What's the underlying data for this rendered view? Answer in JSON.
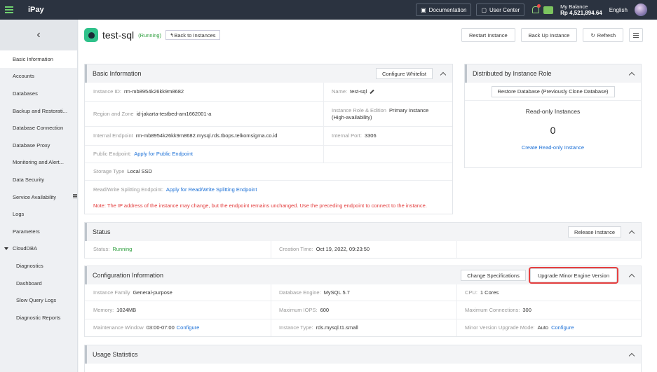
{
  "topbar": {
    "logo": "iPay",
    "documentation": "Documentation",
    "user_center": "User Center",
    "balance_label": "My Balance",
    "balance_value": "Rp 4,521,894.64",
    "language": "English"
  },
  "sidebar": {
    "items": [
      "Basic Information",
      "Accounts",
      "Databases",
      "Backup and Restorati...",
      "Database Connection",
      "Database Proxy",
      "Monitoring and Alert...",
      "Data Security",
      "Service Availability",
      "Logs",
      "Parameters"
    ],
    "group": "CloudDBA",
    "sub_items": [
      "Diagnostics",
      "Dashboard",
      "Slow Query Logs",
      "Diagnostic Reports"
    ]
  },
  "header": {
    "title": "test-sql",
    "status": "(Running)",
    "back": "Back to Instances",
    "restart": "Restart Instance",
    "backup": "Back Up Instance",
    "refresh": "Refresh"
  },
  "basic": {
    "title": "Basic Information",
    "whitelist": "Configure Whitelist",
    "instance_id_label": "Instance ID:",
    "instance_id": "rm-mb8954k26kk9m8682",
    "name_label": "Name:",
    "name": "test-sql",
    "region_label": "Region and Zone",
    "region": "id-jakarta-testbed-am1662001-a",
    "role_label": "Instance Role & Edition",
    "role": "Primary Instance",
    "role_sub": "(High-availability)",
    "internal_label": "Internal Endpoint",
    "internal": "rm-mb8954k26kk9m8682.mysql.rds.tbops.telkomsigma.co.id",
    "port_label": "Internal Port:",
    "port": "3306",
    "public_label": "Public Endpoint:",
    "public_link": "Apply for Public Endpoint",
    "storage_label": "Storage Type",
    "storage": "Local SSD",
    "rw_label": "Read/Write Splitting Endpoint:",
    "rw_link": "Apply for Read/Write Splitting Endpoint",
    "note": "Note: The IP address of the instance may change, but the endpoint remains unchanged. Use the preceding endpoint to connect to the instance."
  },
  "distributed": {
    "title": "Distributed by Instance Role",
    "restore": "Restore Database (Previously Clone Database)",
    "readonly_title": "Read-only Instances",
    "readonly_count": "0",
    "create_link": "Create Read-only Instance"
  },
  "status": {
    "title": "Status",
    "release": "Release Instance",
    "status_label": "Status:",
    "status_value": "Running",
    "creation_label": "Creation Time:",
    "creation_value": "Oct 19, 2022, 09:23:50"
  },
  "config": {
    "title": "Configuration Information",
    "change_spec": "Change Specifications",
    "upgrade": "Upgrade Minor Engine Version",
    "family_label": "Instance Family",
    "family": "General-purpose",
    "engine_label": "Database Engine:",
    "engine": "MySQL 5.7",
    "cpu_label": "CPU:",
    "cpu": "1 Cores",
    "memory_label": "Memory:",
    "memory": "1024MB",
    "iops_label": "Maximum IOPS:",
    "iops": "600",
    "conn_label": "Maximum Connections:",
    "conn": "300",
    "maint_label": "Maintenance Window",
    "maint": "03:00-07:00",
    "maint_link": "Configure",
    "type_label": "Instance Type:",
    "type": "rds.mysql.t1.small",
    "minor_label": "Minor Version Upgrade Mode:",
    "minor": "Auto",
    "minor_link": "Configure"
  },
  "usage": {
    "title": "Usage Statistics"
  },
  "colors": {
    "topbar": "#2b3340",
    "link": "#1a6fd6",
    "running": "#2a9d3a",
    "note": "#e23a3a",
    "highlight": "#e64040"
  }
}
